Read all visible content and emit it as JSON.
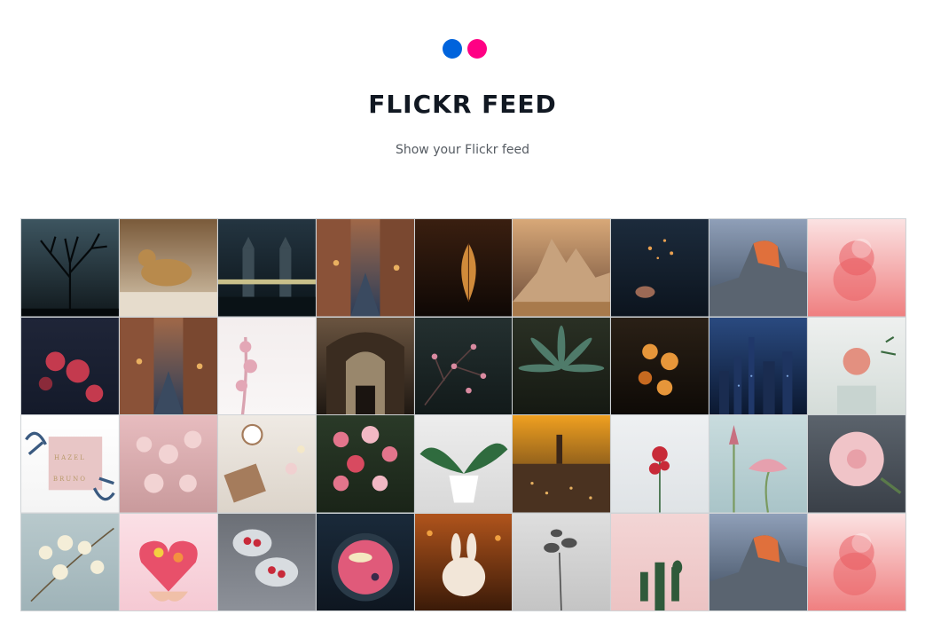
{
  "header": {
    "title": "FLICKR FEED",
    "subtitle": "Show your Flickr feed",
    "logo": {
      "name": "flickr-logo-icon",
      "colors": [
        "#0063dc",
        "#ff0084"
      ]
    }
  },
  "feed": {
    "columns": 9,
    "rows": 4,
    "photos": [
      {
        "name": "photo-bare-tree",
        "bg": [
          "#3d5560",
          "#11191d"
        ],
        "shape": "tree",
        "accent": "#05090b"
      },
      {
        "name": "photo-leopard",
        "bg": [
          "#7a5a3a",
          "#d9c9b0"
        ],
        "shape": "animal",
        "accent": "#b88a4c"
      },
      {
        "name": "photo-tower-bridge",
        "bg": [
          "#243541",
          "#0b1419"
        ],
        "shape": "bridge",
        "accent": "#c9c08a"
      },
      {
        "name": "photo-city-street",
        "bg": [
          "#a06848",
          "#2a3d5a"
        ],
        "shape": "street",
        "accent": "#e9b060"
      },
      {
        "name": "photo-leaf-candle",
        "bg": [
          "#3a1f10",
          "#0f0805"
        ],
        "shape": "leaf",
        "accent": "#d08a3a"
      },
      {
        "name": "photo-mountain-peak",
        "bg": [
          "#d8a878",
          "#6a4a38"
        ],
        "shape": "mountain",
        "accent": "#c7a27d"
      },
      {
        "name": "photo-sparkler-lights",
        "bg": [
          "#1c2b3c",
          "#0c141e"
        ],
        "shape": "bokeh",
        "accent": "#e9a050"
      },
      {
        "name": "photo-half-dome",
        "bg": [
          "#8f9fb8",
          "#3c4a5c"
        ],
        "shape": "dome",
        "accent": "#e0703c"
      },
      {
        "name": "photo-pink-smoke",
        "bg": [
          "#fbe2e2",
          "#ef7f80"
        ],
        "shape": "smoke",
        "accent": "#e8565c"
      },
      {
        "name": "photo-red-roses-dark",
        "bg": [
          "#1f2538",
          "#141a2a"
        ],
        "shape": "roses",
        "accent": "#c43a4e"
      },
      {
        "name": "photo-city-street-2",
        "bg": [
          "#a06848",
          "#2a3d5a"
        ],
        "shape": "street",
        "accent": "#e9b060"
      },
      {
        "name": "photo-cherry-blossom-white",
        "bg": [
          "#f3eeee",
          "#f9f6f6"
        ],
        "shape": "blossom",
        "accent": "#e3a7b6"
      },
      {
        "name": "photo-museum-hall",
        "bg": [
          "#6a5440",
          "#1f1812"
        ],
        "shape": "hall",
        "accent": "#d9c4a0"
      },
      {
        "name": "photo-pink-blossom-dark",
        "bg": [
          "#243030",
          "#121a1a"
        ],
        "shape": "branches",
        "accent": "#d98aa0"
      },
      {
        "name": "photo-green-leaves",
        "bg": [
          "#2a3024",
          "#151912"
        ],
        "shape": "palm",
        "accent": "#4f7b6a"
      },
      {
        "name": "photo-yellow-roses-dark",
        "bg": [
          "#2a2016",
          "#0e0a06"
        ],
        "shape": "yellowroses",
        "accent": "#e6963a"
      },
      {
        "name": "photo-city-night",
        "bg": [
          "#2a4a80",
          "#0b1830"
        ],
        "shape": "skyline",
        "accent": "#7fa8e0"
      },
      {
        "name": "photo-rose-vase",
        "bg": [
          "#eef0ef",
          "#d4dcd8"
        ],
        "shape": "vase",
        "accent": "#e39080"
      },
      {
        "name": "photo-invitation-card",
        "bg": [
          "#ffffff",
          "#f4f4f4"
        ],
        "shape": "card",
        "accent": "#e8c6c6"
      },
      {
        "name": "photo-pink-hydrangea",
        "bg": [
          "#e7bcbf",
          "#c99a9c"
        ],
        "shape": "hydrangea",
        "accent": "#f2d3d3"
      },
      {
        "name": "photo-desk-coffee",
        "bg": [
          "#efeae4",
          "#dcd4ca"
        ],
        "shape": "desk",
        "accent": "#a57c5c"
      },
      {
        "name": "photo-flower-bouquet",
        "bg": [
          "#2a3a28",
          "#1a2418"
        ],
        "shape": "bouquet",
        "accent": "#e3758c"
      },
      {
        "name": "photo-monstera-pot",
        "bg": [
          "#ededed",
          "#d8d8d8"
        ],
        "shape": "monstera",
        "accent": "#2f6b3e"
      },
      {
        "name": "photo-town-sunset",
        "bg": [
          "#f0a020",
          "#3a2618"
        ],
        "shape": "town",
        "accent": "#e6b060"
      },
      {
        "name": "photo-single-red-rose",
        "bg": [
          "#eef0f2",
          "#dfe3e6"
        ],
        "shape": "redrose",
        "accent": "#c82a38"
      },
      {
        "name": "photo-lotus",
        "bg": [
          "#c9dcde",
          "#a9c4c8"
        ],
        "shape": "lotus",
        "accent": "#e6a0ae"
      },
      {
        "name": "photo-peony",
        "bg": [
          "#5b636c",
          "#3a4048"
        ],
        "shape": "peony",
        "accent": "#f0c4c8"
      },
      {
        "name": "photo-white-blossoms",
        "bg": [
          "#b8c9cc",
          "#9fb3b8"
        ],
        "shape": "whiteflowers",
        "accent": "#f4eed8"
      },
      {
        "name": "photo-heart-flowers",
        "bg": [
          "#fbe0e6",
          "#f5c9d3"
        ],
        "shape": "heart",
        "accent": "#e8506a"
      },
      {
        "name": "photo-strawberries",
        "bg": [
          "#6b6f76",
          "#8d9199"
        ],
        "shape": "berries",
        "accent": "#c82a3a"
      },
      {
        "name": "photo-smoothie-bowl",
        "bg": [
          "#1a2a3a",
          "#0e1620"
        ],
        "shape": "bowl",
        "accent": "#e05a7a"
      },
      {
        "name": "photo-bunny",
        "bg": [
          "#b0541c",
          "#3a1a08"
        ],
        "shape": "bunny",
        "accent": "#f2e6d8"
      },
      {
        "name": "photo-grey-plant",
        "bg": [
          "#dedede",
          "#c4c4c4"
        ],
        "shape": "greyplant",
        "accent": "#505050"
      },
      {
        "name": "photo-cactus-pink",
        "bg": [
          "#f3d5d5",
          "#ecc3c3"
        ],
        "shape": "cactus",
        "accent": "#2f5a3a"
      },
      {
        "name": "photo-half-dome-2",
        "bg": [
          "#8f9fb8",
          "#3c4a5c"
        ],
        "shape": "dome",
        "accent": "#e0703c"
      },
      {
        "name": "photo-pink-smoke-2",
        "bg": [
          "#fbe2e2",
          "#ef7f80"
        ],
        "shape": "smoke",
        "accent": "#e8565c"
      }
    ]
  },
  "card_text": {
    "line1": "HAZEL",
    "line2": "BRUNO"
  }
}
